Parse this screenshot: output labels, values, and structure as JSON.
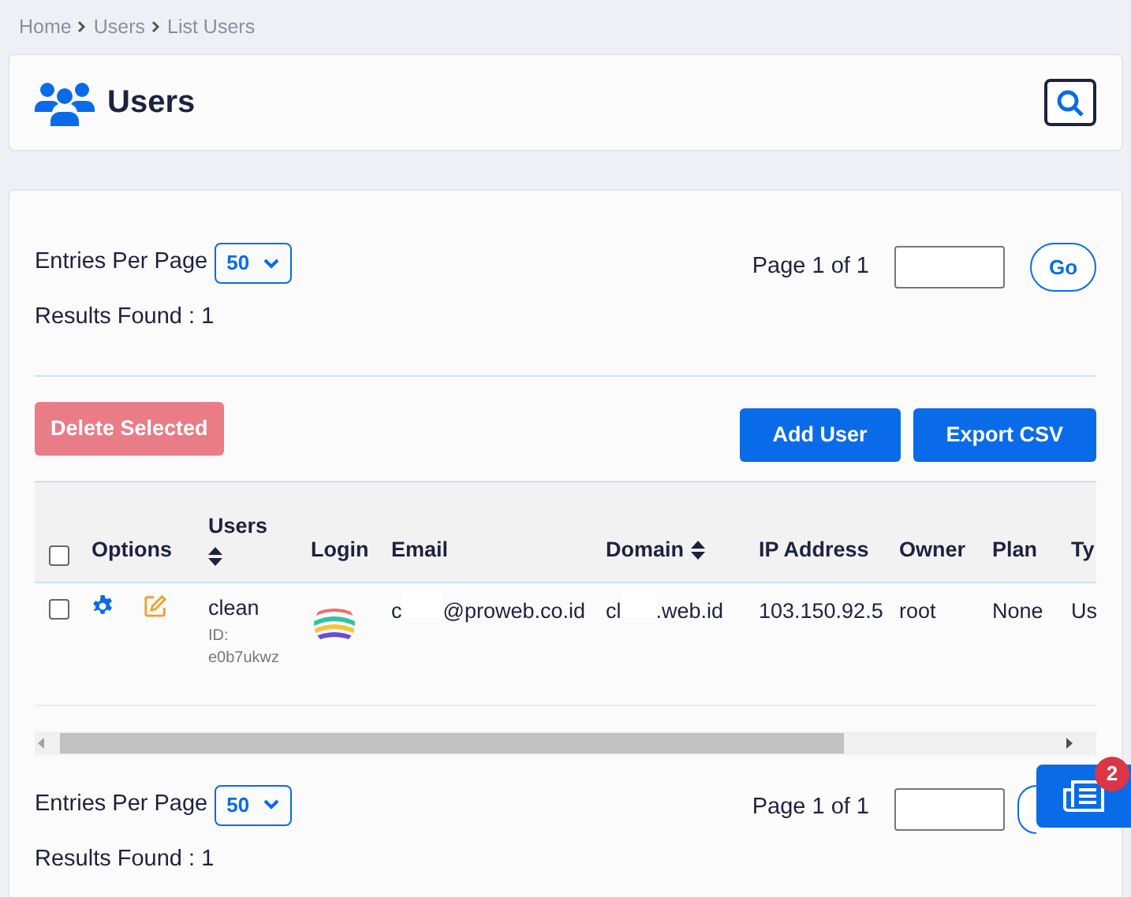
{
  "breadcrumb": [
    "Home",
    "Users",
    "List Users"
  ],
  "page_title": "Users",
  "top_pagination": {
    "entries_label": "Entries Per Page",
    "entries_value": "50",
    "page_label": "Page 1 of 1",
    "go_label": "Go",
    "results": "Results Found : 1"
  },
  "actions": {
    "delete": {
      "label": "Delete Selected",
      "disabled": true
    },
    "buttons": [
      "Add User",
      "Export CSV"
    ]
  },
  "table": {
    "select_all": {
      "checked": false
    },
    "columns": [
      {
        "label": "Options",
        "sortable": false
      },
      {
        "label": "Users",
        "sortable": true
      },
      {
        "label": "Login",
        "sortable": false
      },
      {
        "label": "Email",
        "sortable": false
      },
      {
        "label": "Domain",
        "sortable": true
      },
      {
        "label": "IP Address",
        "sortable": false
      },
      {
        "label": "Owner",
        "sortable": false
      },
      {
        "label": "Plan",
        "sortable": false
      },
      {
        "label": "Ty",
        "sortable": false
      }
    ],
    "rows": [
      {
        "checked": false,
        "user": "clean",
        "user_id": "ID: e0b7ukwz",
        "email_start": "c",
        "email_end": "@proweb.co.id",
        "domain_start": "cl",
        "domain_end": ".web.id",
        "ip": "103.150.92.5",
        "owner": "root",
        "plan": "None",
        "type": "Us"
      }
    ]
  },
  "bottom_pagination": {
    "entries_label": "Entries Per Page",
    "entries_value": "50",
    "page_label": "Page 1 of 1",
    "results": "Results Found : 1"
  },
  "floating_button": {
    "badge": "2"
  }
}
